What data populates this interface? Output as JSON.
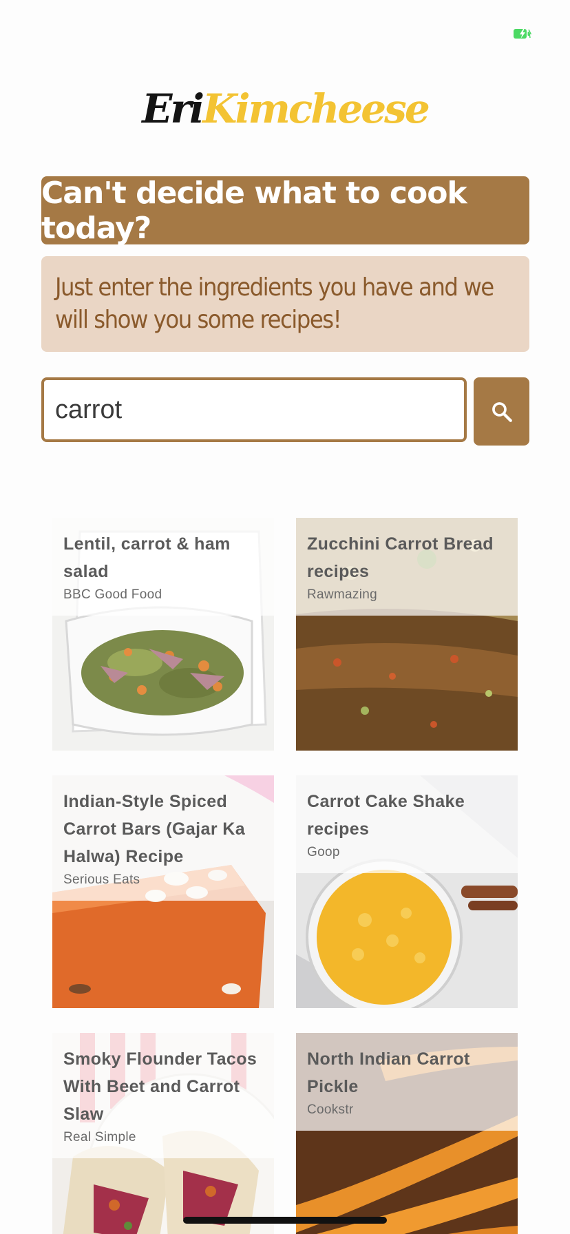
{
  "status_bar": {
    "battery_icon": "battery-charging-icon",
    "battery_color": "#4cd964"
  },
  "logo": {
    "part1": "Eri",
    "part2": "Kimcheese",
    "colors": {
      "part1": "#141414",
      "part2": "#f3c333"
    }
  },
  "headline": "Can't decide what to cook today?",
  "subtitle": "Just enter the ingredients you have and we will show you some recipes!",
  "search": {
    "value": "carrot",
    "placeholder": "",
    "button_icon": "search-icon"
  },
  "colors": {
    "accent": "#a57945",
    "accent_light": "#ead6c5",
    "accent_text": "#8a5a2c"
  },
  "recipes": [
    {
      "title": "Lentil, carrot & ham salad",
      "source": "BBC Good Food",
      "image": "salad-photo"
    },
    {
      "title": "Zucchini Carrot Bread recipes",
      "source": "Rawmazing",
      "image": "bread-photo"
    },
    {
      "title": "Indian-Style Spiced Carrot Bars (Gajar Ka Halwa) Recipe",
      "source": "Serious Eats",
      "image": "halwa-photo"
    },
    {
      "title": "Carrot Cake Shake recipes",
      "source": "Goop",
      "image": "shake-photo"
    },
    {
      "title": "Smoky Flounder Tacos With Beet and Carrot Slaw",
      "source": "Real Simple",
      "image": "tacos-photo"
    },
    {
      "title": "North Indian Carrot Pickle",
      "source": "Cookstr",
      "image": "carrots-photo"
    }
  ]
}
